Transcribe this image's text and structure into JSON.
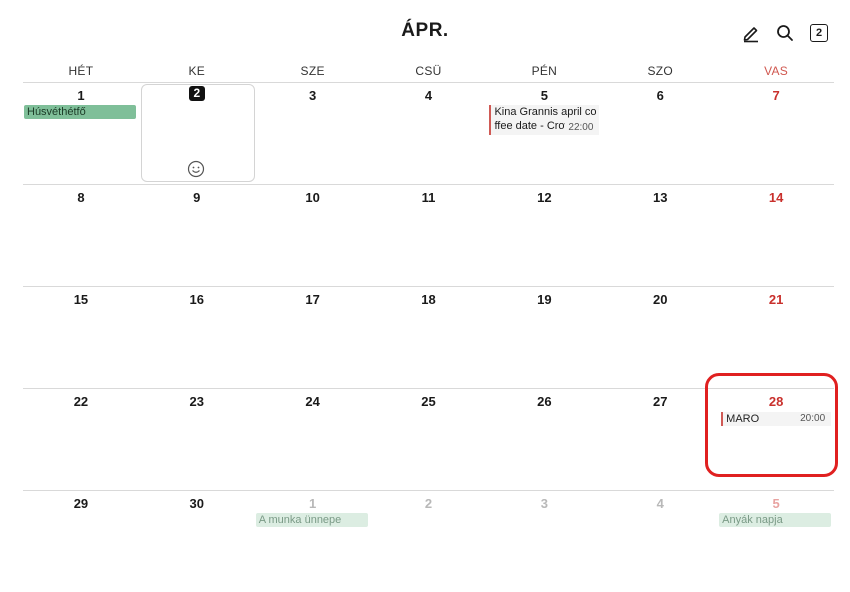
{
  "header": {
    "title": "ÁPR.",
    "today_badge": "2",
    "icons": [
      "pen-icon",
      "search-icon",
      "today-icon"
    ]
  },
  "weekdays": [
    "HÉT",
    "KE",
    "SZE",
    "CSÜ",
    "PÉN",
    "SZO",
    "VAS"
  ],
  "weeks": [
    [
      "1",
      "2",
      "3",
      "4",
      "5",
      "6",
      "7"
    ],
    [
      "8",
      "9",
      "10",
      "11",
      "12",
      "13",
      "14"
    ],
    [
      "15",
      "16",
      "17",
      "18",
      "19",
      "20",
      "21"
    ],
    [
      "22",
      "23",
      "24",
      "25",
      "26",
      "27",
      "28"
    ],
    [
      "29",
      "30",
      "1",
      "2",
      "3",
      "4",
      "5"
    ]
  ],
  "events": {
    "easter_monday": "Húsvéthétfő",
    "kina_title": "Kina Grannis april coffee date - Crow",
    "kina_time": "22:00",
    "maro_title": "MARO",
    "maro_time": "20:00",
    "labor_day": "A munka ünnepe",
    "mothers_day": "Anyák napja"
  },
  "colors": {
    "sunday": "#c9302c",
    "holiday_bg": "#7fbf99",
    "event_accent": "#d05a55",
    "annotation": "#e02020"
  }
}
